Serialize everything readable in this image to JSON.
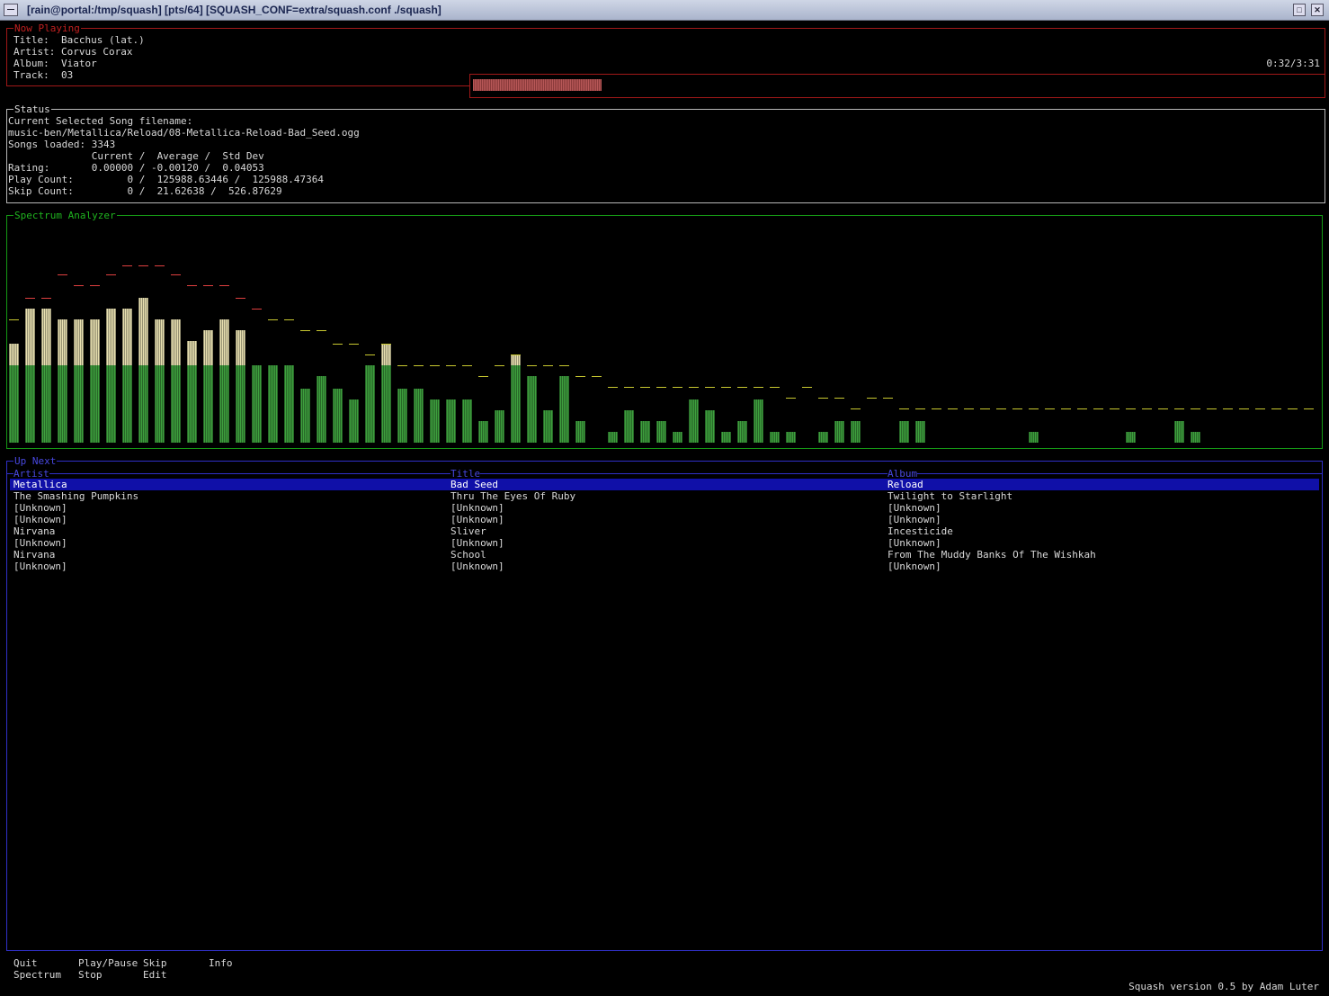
{
  "window": {
    "title": "[rain@portal:/tmp/squash] [pts/64] [SQUASH_CONF=extra/squash.conf ./squash]"
  },
  "now_playing": {
    "legend": "Now Playing",
    "lines": [
      "Title:  Bacchus (lat.)",
      "Artist: Corvus Corax",
      "Album:  Viator",
      "Track:  03"
    ],
    "time": "0:32/3:31",
    "progress": 0.151
  },
  "status": {
    "legend": "Status",
    "lines": [
      "Current Selected Song filename:",
      "music-ben/Metallica/Reload/08-Metallica-Reload-Bad_Seed.ogg",
      "Songs loaded: 3343",
      "              Current /  Average /  Std Dev",
      "Rating:       0.00000 / -0.00120 /  0.04053",
      "Play Count:         0 /  125988.63446 /  125988.47364",
      "Skip Count:         0 /  21.62638 /  526.87629"
    ]
  },
  "spectrum": {
    "legend": "Spectrum Analyzer",
    "levels": [
      0.46,
      0.62,
      0.62,
      0.57,
      0.57,
      0.57,
      0.62,
      0.62,
      0.67,
      0.57,
      0.57,
      0.47,
      0.52,
      0.57,
      0.52,
      0.36,
      0.36,
      0.36,
      0.25,
      0.31,
      0.25,
      0.2,
      0.36,
      0.46,
      0.25,
      0.25,
      0.2,
      0.2,
      0.2,
      0.1,
      0.15,
      0.41,
      0.31,
      0.15,
      0.31,
      0.1,
      0,
      0.05,
      0.15,
      0.1,
      0.1,
      0.05,
      0.2,
      0.15,
      0.05,
      0.1,
      0.2,
      0.05,
      0.05,
      0,
      0.05,
      0.1,
      0.1,
      0,
      0,
      0.1,
      0.1,
      0,
      0,
      0,
      0,
      0,
      0,
      0.05,
      0,
      0,
      0,
      0,
      0,
      0.05,
      0,
      0,
      0.1,
      0.05,
      0,
      0,
      0,
      0,
      0,
      0,
      0
    ],
    "peaks": [
      0.57,
      0.67,
      0.67,
      0.78,
      0.73,
      0.73,
      0.78,
      0.82,
      0.82,
      0.82,
      0.78,
      0.73,
      0.73,
      0.73,
      0.67,
      0.62,
      0.57,
      0.57,
      0.52,
      0.52,
      0.46,
      0.46,
      0.41,
      0.46,
      0.36,
      0.36,
      0.36,
      0.36,
      0.36,
      0.31,
      0.36,
      0.41,
      0.36,
      0.36,
      0.36,
      0.31,
      0.31,
      0.26,
      0.26,
      0.26,
      0.26,
      0.26,
      0.26,
      0.26,
      0.26,
      0.26,
      0.26,
      0.26,
      0.21,
      0.26,
      0.21,
      0.21,
      0.16,
      0.21,
      0.21,
      0.16,
      0.16,
      0.16,
      0.16,
      0.16,
      0.16,
      0.16,
      0.16,
      0.16,
      0.16,
      0.16,
      0.16,
      0.16,
      0.16,
      0.16,
      0.16,
      0.16,
      0.16,
      0.16,
      0.16,
      0.16,
      0.16,
      0.16,
      0.16,
      0.16,
      0.16
    ],
    "colors": {
      "low": "#3ea03e",
      "mid": "#e8e0b0",
      "peak_high": "#e04040",
      "peak_low": "#c8c830"
    }
  },
  "up_next": {
    "legend": "Up Next",
    "columns": [
      "Artist",
      "Title",
      "Album"
    ],
    "rows": [
      [
        "Metallica",
        "Bad Seed",
        "Reload"
      ],
      [
        "The Smashing Pumpkins",
        "Thru The Eyes Of Ruby",
        "Twilight to Starlight"
      ],
      [
        "[Unknown]",
        "[Unknown]",
        "[Unknown]"
      ],
      [
        "[Unknown]",
        "[Unknown]",
        "[Unknown]"
      ],
      [
        "Nirvana",
        "Sliver",
        "Incesticide"
      ],
      [
        "[Unknown]",
        "[Unknown]",
        "[Unknown]"
      ],
      [
        "Nirvana",
        "School",
        "From The Muddy Banks Of The Wishkah"
      ],
      [
        "[Unknown]",
        "[Unknown]",
        "[Unknown]"
      ]
    ],
    "selected_index": 0
  },
  "function_keys": {
    "quit": "Quit",
    "play_pause": "Play/Pause",
    "skip": "Skip",
    "info": "Info",
    "spectrum": "Spectrum",
    "stop": "Stop",
    "edit": "Edit"
  },
  "footer": {
    "version": "Squash version 0.5 by Adam Luter"
  }
}
